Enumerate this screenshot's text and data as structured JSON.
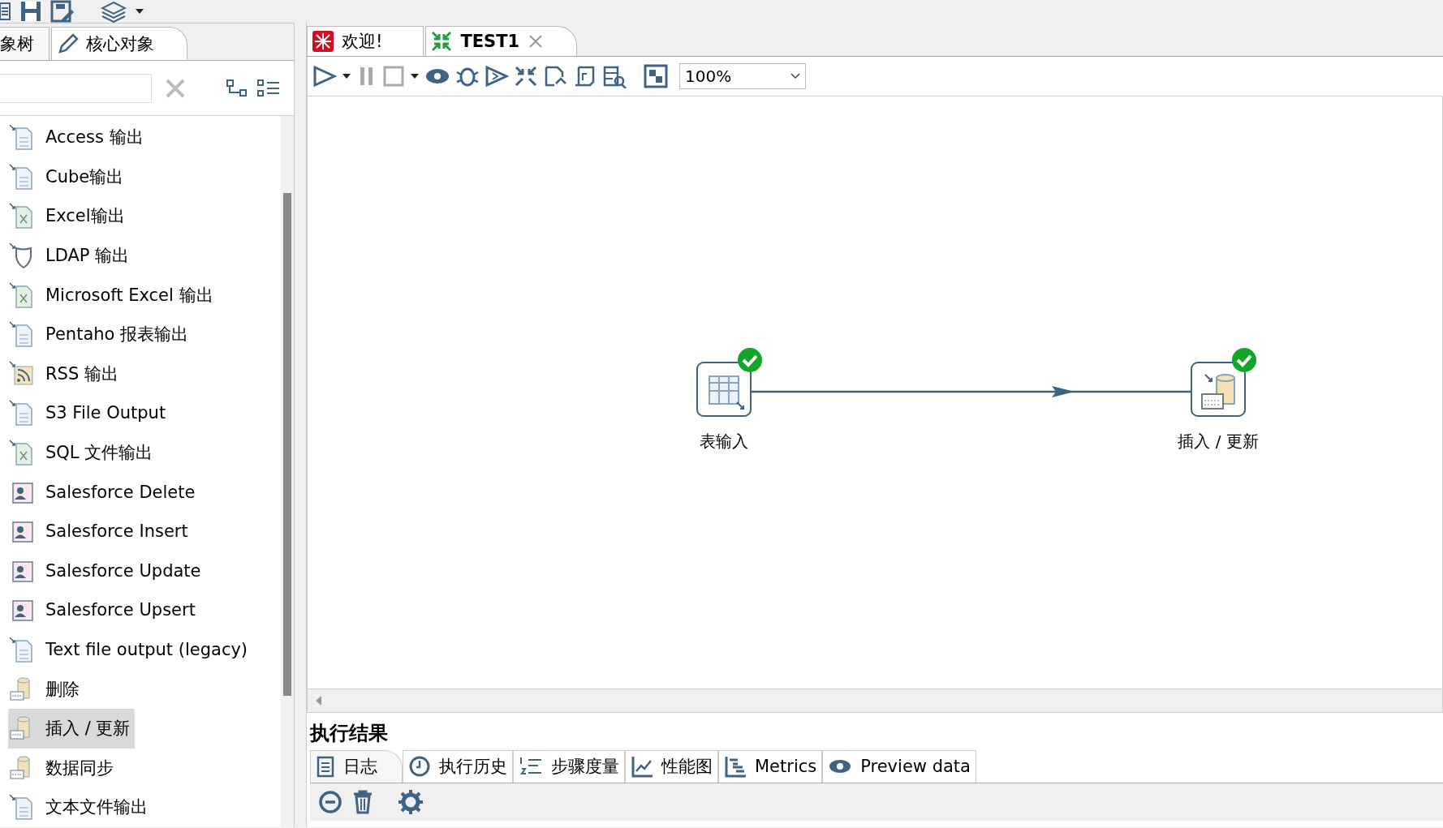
{
  "palette": {
    "tabs": [
      {
        "label": "象树",
        "selected": false
      },
      {
        "label": "核心对象",
        "selected": true
      }
    ],
    "items": [
      {
        "label": "Access 输出",
        "kind": "file",
        "selected": false
      },
      {
        "label": "Cube输出",
        "kind": "file",
        "selected": false
      },
      {
        "label": "Excel输出",
        "kind": "sheet",
        "selected": false
      },
      {
        "label": "LDAP 输出",
        "kind": "shield",
        "selected": false
      },
      {
        "label": "Microsoft Excel 输出",
        "kind": "sheet",
        "selected": false
      },
      {
        "label": "Pentaho 报表输出",
        "kind": "file",
        "selected": false
      },
      {
        "label": "RSS 输出",
        "kind": "rss",
        "selected": false
      },
      {
        "label": "S3 File Output",
        "kind": "file",
        "selected": false
      },
      {
        "label": "SQL 文件输出",
        "kind": "sheet",
        "selected": false
      },
      {
        "label": "Salesforce Delete",
        "kind": "person",
        "selected": false
      },
      {
        "label": "Salesforce Insert",
        "kind": "person",
        "selected": false
      },
      {
        "label": "Salesforce Update",
        "kind": "person",
        "selected": false
      },
      {
        "label": "Salesforce Upsert",
        "kind": "person",
        "selected": false
      },
      {
        "label": "Text file output (legacy)",
        "kind": "file",
        "selected": false
      },
      {
        "label": "删除",
        "kind": "db",
        "selected": false
      },
      {
        "label": "插入 / 更新",
        "kind": "db",
        "selected": true
      },
      {
        "label": "数据同步",
        "kind": "db",
        "selected": false
      },
      {
        "label": "文本文件输出",
        "kind": "file",
        "selected": false
      }
    ]
  },
  "editor": {
    "tabs": [
      {
        "label": "欢迎!",
        "kind": "welcome",
        "selected": false,
        "closable": false
      },
      {
        "label": "TEST1",
        "kind": "transform",
        "selected": true,
        "closable": true
      }
    ],
    "zoom": "100%",
    "nodes": [
      {
        "label": "表输入",
        "kind": "table",
        "done": true
      },
      {
        "label": "插入 / 更新",
        "kind": "db",
        "done": true
      }
    ]
  },
  "results": {
    "title": "执行结果",
    "tabs": [
      {
        "label": "日志",
        "kind": "log",
        "selected": true
      },
      {
        "label": "执行历史",
        "kind": "history",
        "selected": false
      },
      {
        "label": "步骤度量",
        "kind": "steps",
        "selected": false
      },
      {
        "label": "性能图",
        "kind": "chart",
        "selected": false
      },
      {
        "label": "Metrics",
        "kind": "metrics",
        "selected": false
      },
      {
        "label": "Preview data",
        "kind": "eye",
        "selected": false
      }
    ]
  }
}
